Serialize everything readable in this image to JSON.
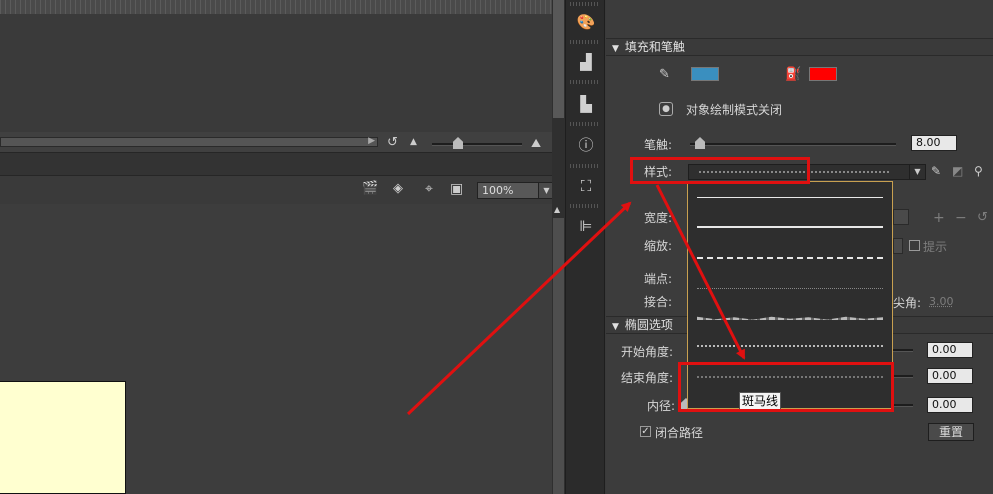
{
  "zoom": {
    "value": "100%"
  },
  "fill_stroke": {
    "title": "填充和笔触",
    "stroke_color": "#3a8fbf",
    "fill_color": "#ff0000",
    "object_draw_label": "对象绘制模式关闭",
    "stroke_label": "笔触:",
    "stroke_value": "8.00",
    "stroke_fraction": 0.0,
    "style_label": "样式:",
    "width_label": "宽度:",
    "scale_label": "缩放:",
    "hint_label": "提示",
    "cap_label": "端点:",
    "join_label": "接合:",
    "miter_label": "尖角:",
    "miter_value": "3.00"
  },
  "ellipse": {
    "title": "椭圆选项",
    "start_label": "开始角度:",
    "start_value": "0.00",
    "end_label": "结束角度:",
    "end_value": "0.00",
    "inner_label": "内径:",
    "inner_value": "0.00",
    "close_path_label": "闭合路径",
    "close_path_checked": true,
    "reset_label": "重置"
  },
  "style_dropdown": {
    "options": [
      "极细线",
      "实线",
      "虚线",
      "点状线",
      "锯齿线",
      "点刻线",
      "斑马线"
    ],
    "tooltip": "斑马线"
  },
  "annotation_color": "#e01010"
}
